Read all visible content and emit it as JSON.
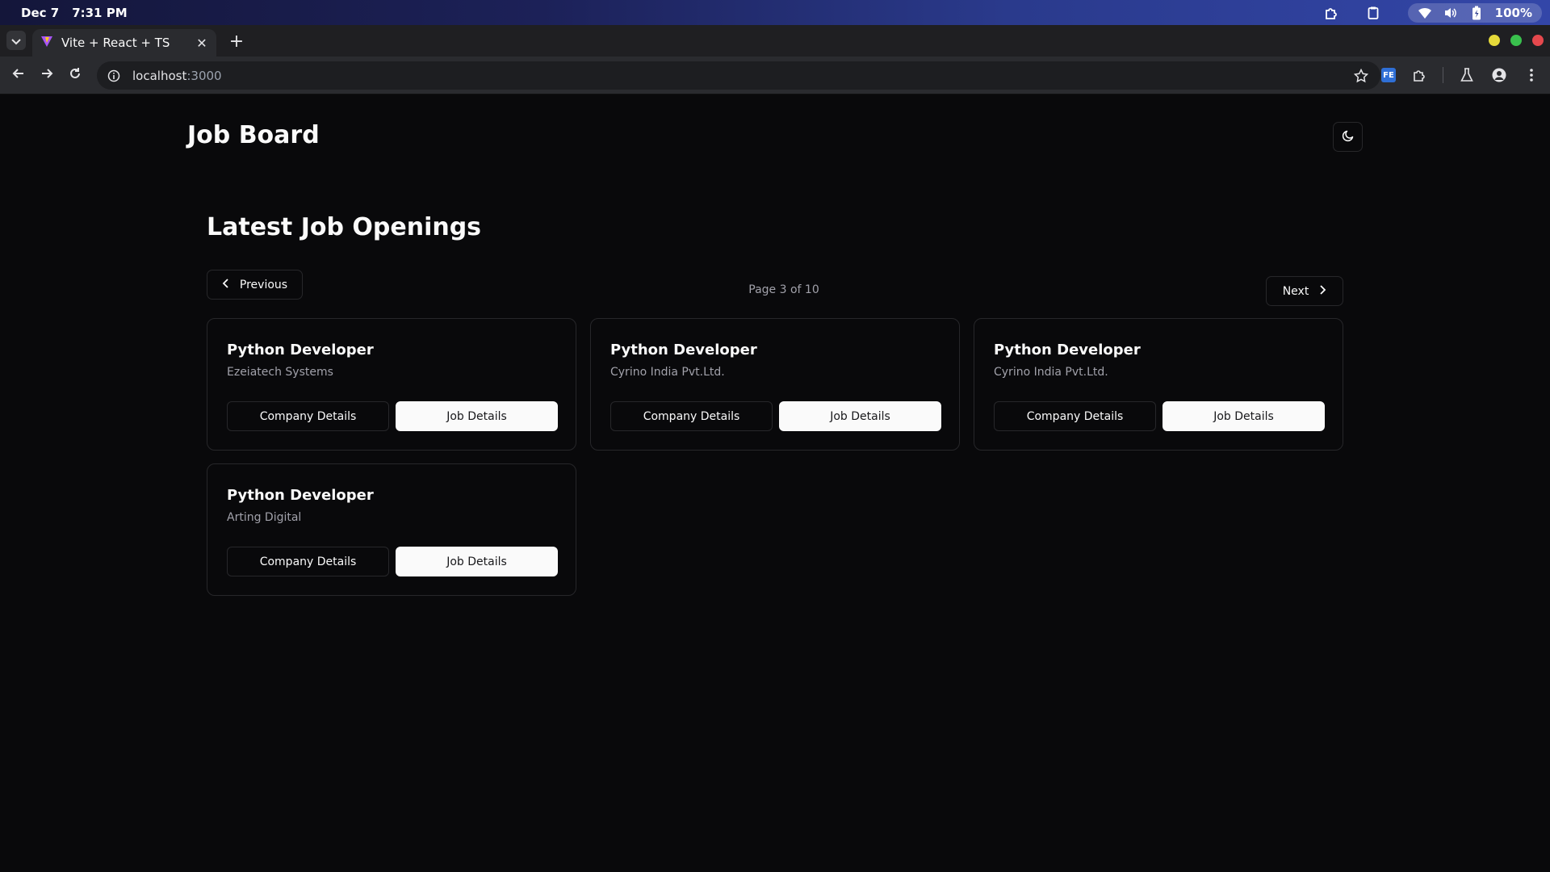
{
  "os": {
    "date": "Dec 7",
    "time": "7:31 PM",
    "battery": "100%",
    "icons": [
      "extension-puzzle-icon",
      "clipboard-icon",
      "wifi-icon",
      "volume-icon",
      "battery-icon"
    ]
  },
  "browser": {
    "tab_title": "Vite + React + TS",
    "url_host": "localhost",
    "url_port": ":3000",
    "extension_badge": "FE",
    "window_controls_colors": [
      "#e5d93a",
      "#39c04d",
      "#e5484d"
    ]
  },
  "app": {
    "title": "Job Board",
    "section_title": "Latest Job Openings",
    "pagination": {
      "previous_label": "Previous",
      "next_label": "Next",
      "indicator": "Page 3 of 10"
    },
    "jobs": [
      {
        "title": "Python Developer",
        "company": "Ezeiatech Systems",
        "company_btn": "Company Details",
        "job_btn": "Job Details"
      },
      {
        "title": "Python Developer",
        "company": "Cyrino India Pvt.Ltd.",
        "company_btn": "Company Details",
        "job_btn": "Job Details"
      },
      {
        "title": "Python Developer",
        "company": "Cyrino India Pvt.Ltd.",
        "company_btn": "Company Details",
        "job_btn": "Job Details"
      },
      {
        "title": "Python Developer",
        "company": "Arting Digital",
        "company_btn": "Company Details",
        "job_btn": "Job Details"
      }
    ]
  },
  "colors": {
    "background": "#09090b",
    "border": "#27272a",
    "muted_text": "#a1a1aa",
    "primary_button": "#fafafa"
  }
}
